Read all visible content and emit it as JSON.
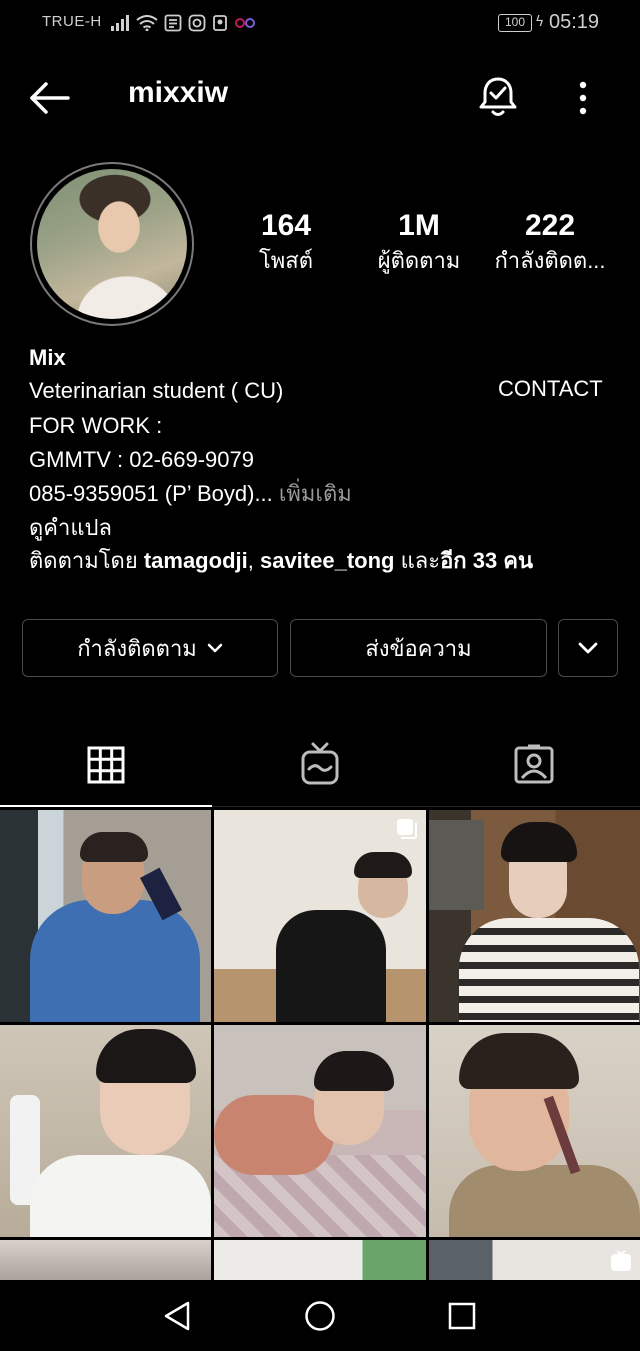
{
  "status_bar": {
    "carrier": "TRUE-H",
    "battery": "100",
    "time": "05:19"
  },
  "header": {
    "username": "mixxiw"
  },
  "stats": [
    {
      "value": "164",
      "label": "โพสต์"
    },
    {
      "value": "1M",
      "label": "ผู้ติดตาม"
    },
    {
      "value": "222",
      "label": "กำลังติดต..."
    }
  ],
  "bio": {
    "name": "Mix",
    "line1": "Veterinarian student ( CU)",
    "contact": "CONTACT",
    "line2": "FOR WORK :",
    "line3": "GMMTV : 02-669-9079",
    "line4": "085-9359051 (P’ Boyd)...",
    "more": " เพิ่มเติม",
    "translate": "ดูคำแปล",
    "followed_prefix": "ติดตามโดย ",
    "followed_user1": "tamagodji",
    "followed_sep": ", ",
    "followed_user2": "savitee_tong",
    "followed_and": " และ",
    "followed_count": "อีก 33 คน"
  },
  "buttons": {
    "following": "กำลังติดตาม",
    "message": "ส่งข้อความ"
  },
  "tabs": {
    "active": "grid",
    "items": [
      "grid-posts",
      "igtv",
      "tagged"
    ]
  },
  "icons": {
    "back": "back-arrow-icon",
    "bell": "notification-bell-icon",
    "more": "more-vertical-icon",
    "chevron": "chevron-down-icon",
    "multi": "multiple-photos-icon",
    "igtv": "igtv-icon"
  },
  "colors": {
    "background": "#000000",
    "text": "#ffffff",
    "muted": "#9a9a9a",
    "border": "#4a4a4a"
  }
}
